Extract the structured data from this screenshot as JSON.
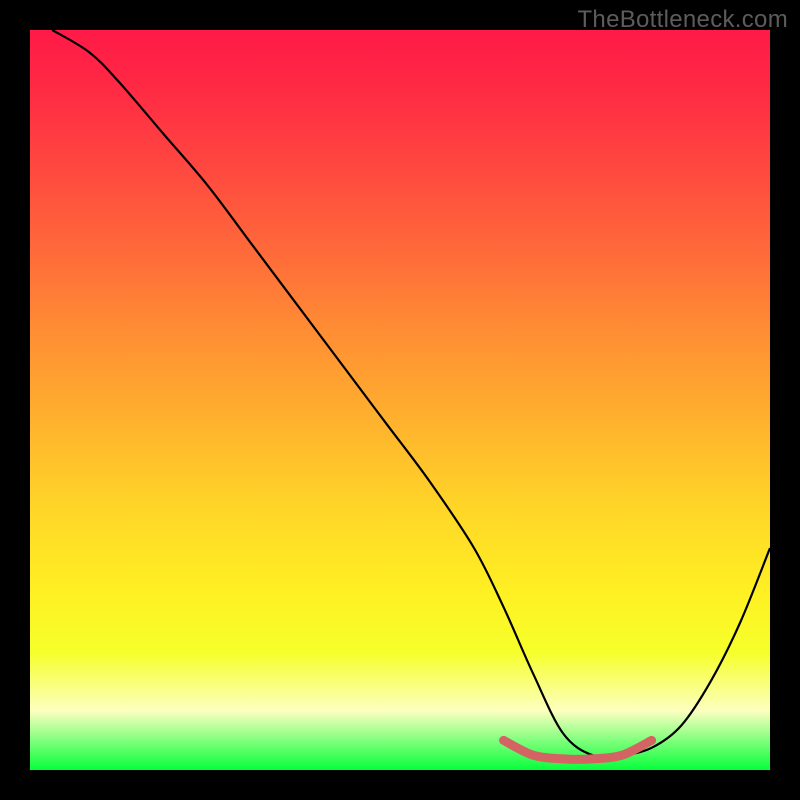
{
  "watermark": "TheBottleneck.com",
  "chart_data": {
    "type": "line",
    "title": "",
    "xlabel": "",
    "ylabel": "",
    "xlim": [
      0,
      100
    ],
    "ylim": [
      0,
      100
    ],
    "gradient_meaning": "vertical gradient from red (top, ~100) through orange/yellow (mid) to green (bottom, ~0)",
    "series": [
      {
        "name": "bottleneck-curve",
        "color": "#000000",
        "x": [
          3,
          8,
          12,
          18,
          24,
          30,
          36,
          42,
          48,
          54,
          60,
          64,
          68,
          72,
          76,
          80,
          84,
          88,
          92,
          96,
          100
        ],
        "y": [
          100,
          97,
          93,
          86,
          79,
          71,
          63,
          55,
          47,
          39,
          30,
          22,
          13,
          5,
          2,
          2,
          3,
          6,
          12,
          20,
          30
        ]
      },
      {
        "name": "optimal-range-marker",
        "color": "#d86b6b",
        "x": [
          64,
          68,
          72,
          76,
          80,
          84
        ],
        "y": [
          4,
          2,
          1.5,
          1.5,
          2,
          4
        ]
      }
    ]
  }
}
